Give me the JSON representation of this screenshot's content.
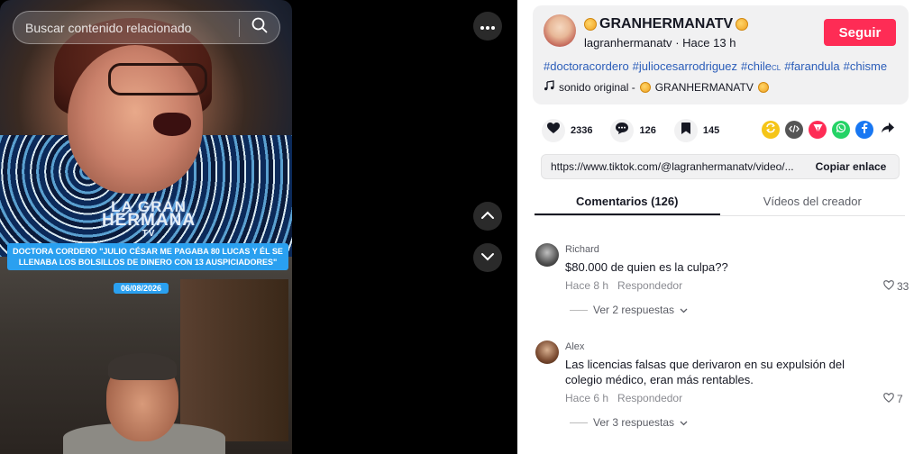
{
  "search": {
    "placeholder": "Buscar contenido relacionado"
  },
  "video": {
    "logo_line1": "LA GRAN",
    "logo_line2": "HERMANA",
    "logo_line3": "TV",
    "caption": "DOCTORA CORDERO \"JULIO CÉSAR ME PAGABA 80 LUCAS Y ÉL SE LLENABA LOS BOLSILLOS DE DINERO CON 13 AUSPICIADORES\"",
    "caption_date": "06/08/2026"
  },
  "author": {
    "name": "GRANHERMANATV",
    "handle": "lagranhermanatv",
    "separator": "·",
    "time": "Hace 13 h",
    "follow_label": "Seguir"
  },
  "hashtags": [
    "#doctoracordero",
    "#juliocesarrodriguez",
    "#chile",
    "#farandula",
    "#chisme"
  ],
  "hashtag_chile_suffix": "CL",
  "sound": {
    "text": "sonido original - ",
    "artist": "GRANHERMANATV"
  },
  "actions": {
    "likes": "2336",
    "comments": "126",
    "saves": "145"
  },
  "share_colors": {
    "repost": "#f5c518",
    "embed": "#555555",
    "friends": "#fe2c55",
    "whatsapp": "#25d366",
    "facebook": "#1877f2"
  },
  "link": {
    "url": "https://www.tiktok.com/@lagranhermanatv/video/...",
    "copy_label": "Copiar enlace"
  },
  "tabs": [
    {
      "label": "Comentarios (126)",
      "active": true
    },
    {
      "label": "Vídeos del creador",
      "active": false
    }
  ],
  "comments": [
    {
      "user": "Richard",
      "text": "$80.000 de quien es la culpa??",
      "time": "Hace 8 h",
      "reply_label": "Respondedor",
      "likes": "33",
      "more_label": "Ver 2 respuestas"
    },
    {
      "user": "Alex",
      "text": "Las licencias falsas que derivaron en su expulsión del colegio médico, eran más rentables.",
      "time": "Hace 6 h",
      "reply_label": "Respondedor",
      "likes": "7",
      "more_label": "Ver 3 respuestas"
    }
  ]
}
